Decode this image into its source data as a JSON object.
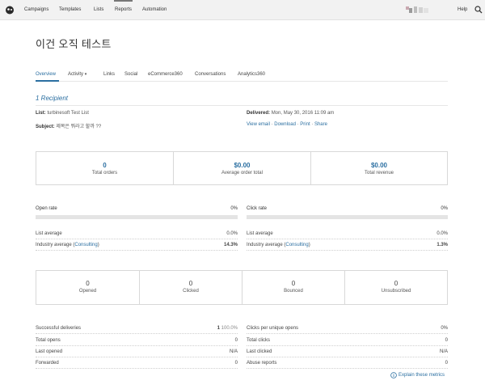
{
  "nav": {
    "items": [
      "Campaigns",
      "Templates",
      "Lists",
      "Reports",
      "Automation"
    ],
    "active": "Reports",
    "help": "Help"
  },
  "campaign": {
    "title": "이건 오직 테스트"
  },
  "tabs": [
    "Overview",
    "Activity",
    "Links",
    "Social",
    "eCommerce360",
    "Conversations",
    "Analytics360"
  ],
  "summary": {
    "recipients": "1 Recipient",
    "list_label": "List:",
    "list_value": "turbinesoft Test List",
    "subject_label": "Subject:",
    "subject_value": "제목은 뭐라고 할까 ??",
    "delivered_label": "Delivered:",
    "delivered_value": "Mon, May 30, 2016 11:09 am",
    "links": {
      "view_email": "View email",
      "download": "Download",
      "print": "Print",
      "share": "Share",
      "sep": " · "
    }
  },
  "ecommerce": [
    {
      "value": "0",
      "label": "Total orders"
    },
    {
      "value": "$0.00",
      "label": "Average order total"
    },
    {
      "value": "$0.00",
      "label": "Total revenue"
    }
  ],
  "rates": {
    "open": {
      "label": "Open rate",
      "value": "0%",
      "fraction": 0
    },
    "click": {
      "label": "Click rate",
      "value": "0%",
      "fraction": 0
    },
    "open_list_avg": {
      "label": "List average",
      "value": "0.0%"
    },
    "open_industry_avg": {
      "label": "Industry average (",
      "link": "Consulting",
      "suffix": ")",
      "value": "14.3%"
    },
    "click_list_avg": {
      "label": "List average",
      "value": "0.0%"
    },
    "click_industry_avg": {
      "label": "Industry average (",
      "link": "Consulting",
      "suffix": ")",
      "value": "1.3%"
    }
  },
  "counts": [
    {
      "value": "0",
      "label": "Opened"
    },
    {
      "value": "0",
      "label": "Clicked"
    },
    {
      "value": "0",
      "label": "Bounced"
    },
    {
      "value": "0",
      "label": "Unsubscribed"
    }
  ],
  "stats_left": [
    {
      "label": "Successful deliveries",
      "value": "1",
      "extra": "100.0%"
    },
    {
      "label": "Total opens",
      "value": "0"
    },
    {
      "label": "Last opened",
      "value": "N/A"
    },
    {
      "label": "Forwarded",
      "value": "0"
    }
  ],
  "stats_right": [
    {
      "label": "Clicks per unique opens",
      "value": "0%"
    },
    {
      "label": "Total clicks",
      "value": "0"
    },
    {
      "label": "Last clicked",
      "value": "N/A"
    },
    {
      "label": "Abuse reports",
      "value": "0"
    }
  ],
  "explain": "Explain these metrics",
  "colors": {
    "link": "#2b6fa1",
    "nav_bg": "#f2f2f2"
  }
}
